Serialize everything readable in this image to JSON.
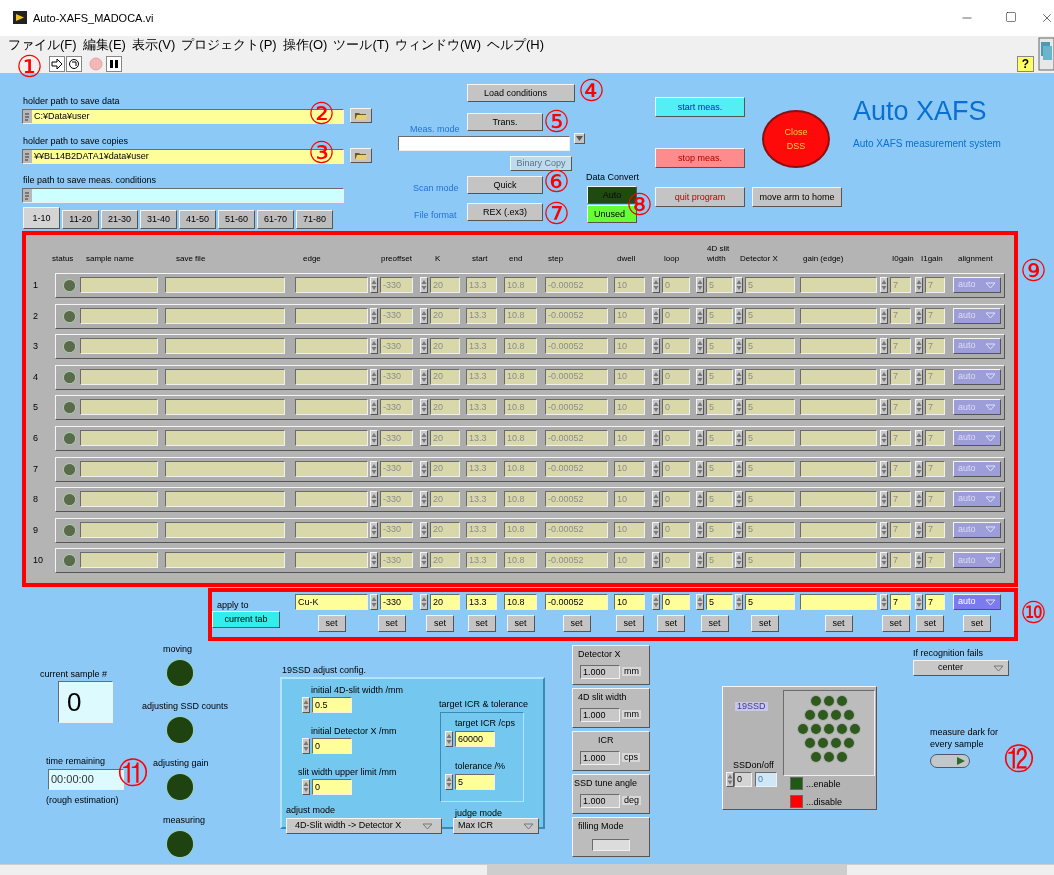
{
  "window": {
    "title": "Auto-XAFS_MADOCA.vi"
  },
  "menu": [
    "ファイル(F)",
    "編集(E)",
    "表示(V)",
    "プロジェクト(P)",
    "操作(O)",
    "ツール(T)",
    "ウィンドウ(W)",
    "ヘルプ(H)"
  ],
  "help_button": "?",
  "paths": [
    {
      "label": "holder path to save data",
      "value": "C:¥Data¥user",
      "browse": true
    },
    {
      "label": "holder path to save copies",
      "value": "¥¥BL14B2DATA1¥data¥user",
      "browse": true
    },
    {
      "label": "file path to save meas. conditions",
      "browse": false
    }
  ],
  "tabs": [
    {
      "label": "1-10",
      "selected": true
    },
    {
      "label": "11-20",
      "selected": false
    },
    {
      "label": "21-30",
      "selected": false
    },
    {
      "label": "31-40",
      "selected": false
    },
    {
      "label": "41-50",
      "selected": false
    },
    {
      "label": "51-60",
      "selected": false
    },
    {
      "label": "61-70",
      "selected": false
    },
    {
      "label": "71-80",
      "selected": false
    }
  ],
  "load_button": "Load conditions",
  "meas_mode": {
    "label": "Meas. mode",
    "value": "Trans."
  },
  "binary_copy": {
    "label": "Binary Copy",
    "disabled": true
  },
  "scan_mode": {
    "label": "Scan mode",
    "value": "Quick"
  },
  "file_format": {
    "label": "File format",
    "value": "REX (.ex3)"
  },
  "data_convert": {
    "label": "Data Convert",
    "options": [
      {
        "label": "Auto",
        "selected": false
      },
      {
        "label": "Unused",
        "selected": true
      }
    ]
  },
  "actions": [
    {
      "label": "start meas.",
      "kind": "start"
    },
    {
      "label": "stop meas.",
      "kind": "stop"
    },
    {
      "label": "quit program",
      "kind": "quit"
    },
    {
      "label": "move arm to home",
      "kind": "home"
    }
  ],
  "close_dss": "Close DSS",
  "brand": {
    "title": "Auto XAFS",
    "subtitle": "Auto XAFS measurement system"
  },
  "table": {
    "columns": [
      {
        "label": "status",
        "kind": "led"
      },
      {
        "label": "sample name",
        "kind": "field"
      },
      {
        "label": "save file",
        "kind": "field"
      },
      {
        "label": "edge",
        "kind": "field"
      },
      {
        "label": "preoffset",
        "kind": "spin"
      },
      {
        "label": "K",
        "kind": "spin"
      },
      {
        "label": "start",
        "kind": "field"
      },
      {
        "label": "end",
        "kind": "field"
      },
      {
        "label": "step",
        "kind": "field"
      },
      {
        "label": "dwell",
        "kind": "field"
      },
      {
        "label": "loop",
        "kind": "spin"
      },
      {
        "label": "4D slit width",
        "kind": "spin"
      },
      {
        "label": "Detector X",
        "kind": "spin"
      },
      {
        "label": "gain (edge)",
        "kind": "field"
      },
      {
        "label": "I0gain",
        "kind": "spin"
      },
      {
        "label": "I1gain",
        "kind": "spin"
      },
      {
        "label": "alignment",
        "kind": "menu"
      }
    ],
    "rows": [
      {
        "number": "1",
        "on": false,
        "cells": [
          "",
          "",
          "",
          "",
          "-330",
          "20",
          "13.3",
          "10.8",
          "-0.00052",
          "10",
          "0",
          "5",
          "5",
          "",
          "7",
          "7",
          "auto"
        ]
      },
      {
        "number": "2",
        "on": false,
        "cells": [
          "",
          "",
          "",
          "",
          "-330",
          "20",
          "13.3",
          "10.8",
          "-0.00052",
          "10",
          "0",
          "5",
          "5",
          "",
          "7",
          "7",
          "auto"
        ]
      },
      {
        "number": "3",
        "on": false,
        "cells": [
          "",
          "",
          "",
          "",
          "-330",
          "20",
          "13.3",
          "10.8",
          "-0.00052",
          "10",
          "0",
          "5",
          "5",
          "",
          "7",
          "7",
          "auto"
        ]
      },
      {
        "number": "4",
        "on": false,
        "cells": [
          "",
          "",
          "",
          "",
          "-330",
          "20",
          "13.3",
          "10.8",
          "-0.00052",
          "10",
          "0",
          "5",
          "5",
          "",
          "7",
          "7",
          "auto"
        ]
      },
      {
        "number": "5",
        "on": false,
        "cells": [
          "",
          "",
          "",
          "",
          "-330",
          "20",
          "13.3",
          "10.8",
          "-0.00052",
          "10",
          "0",
          "5",
          "5",
          "",
          "7",
          "7",
          "auto"
        ]
      },
      {
        "number": "6",
        "on": false,
        "cells": [
          "",
          "",
          "",
          "",
          "-330",
          "20",
          "13.3",
          "10.8",
          "-0.00052",
          "10",
          "0",
          "5",
          "5",
          "",
          "7",
          "7",
          "auto"
        ]
      },
      {
        "number": "7",
        "on": false,
        "cells": [
          "",
          "",
          "",
          "",
          "-330",
          "20",
          "13.3",
          "10.8",
          "-0.00052",
          "10",
          "0",
          "5",
          "5",
          "",
          "7",
          "7",
          "auto"
        ]
      },
      {
        "number": "8",
        "on": false,
        "cells": [
          "",
          "",
          "",
          "",
          "-330",
          "20",
          "13.3",
          "10.8",
          "-0.00052",
          "10",
          "0",
          "5",
          "5",
          "",
          "7",
          "7",
          "auto"
        ]
      },
      {
        "number": "9",
        "on": false,
        "cells": [
          "",
          "",
          "",
          "",
          "-330",
          "20",
          "13.3",
          "10.8",
          "-0.00052",
          "10",
          "0",
          "5",
          "5",
          "",
          "7",
          "7",
          "auto"
        ]
      },
      {
        "number": "10",
        "on": false,
        "cells": [
          "",
          "",
          "",
          "",
          "-330",
          "20",
          "13.3",
          "10.8",
          "-0.00052",
          "10",
          "0",
          "5",
          "5",
          "",
          "7",
          "7",
          "auto"
        ]
      }
    ]
  },
  "apply": {
    "label": "apply to",
    "target_button": "current tab",
    "cells": [
      {
        "value": "Cu-K",
        "button": "set"
      },
      {
        "value": "-330",
        "button": "set"
      },
      {
        "value": "20",
        "button": "set"
      },
      {
        "value": "13.3",
        "button": "set"
      },
      {
        "value": "10.8",
        "button": "set"
      },
      {
        "value": "-0.00052",
        "button": "set"
      },
      {
        "value": "10",
        "button": "set"
      },
      {
        "value": "0",
        "button": "set"
      },
      {
        "value": "5",
        "button": "set"
      },
      {
        "value": "5",
        "button": "set"
      },
      {
        "button": "set"
      },
      {
        "value": "7",
        "button": "set"
      },
      {
        "value": "7",
        "button": "set"
      },
      {
        "value": "auto",
        "button": "set"
      }
    ]
  },
  "current_sample": {
    "label": "current sample #",
    "value": "0"
  },
  "time_remaining": {
    "label": "time remaining",
    "value": "00:00:00",
    "note": "(rough estimation)"
  },
  "indicators": [
    {
      "label": "moving",
      "on": false
    },
    {
      "label": "adjusting SSD counts",
      "on": false
    },
    {
      "label": "adjusting gain",
      "on": false
    },
    {
      "label": "measuring",
      "on": false
    }
  ],
  "ssd_adjust": {
    "title": "19SSD adjust config.",
    "fields": [
      {
        "label": "initial 4D-slit width /mm",
        "value": "0.5"
      },
      {
        "label": "initial Detector X /mm",
        "value": "0"
      },
      {
        "label": "slit width upper limit /mm",
        "value": "0"
      }
    ],
    "target_group": {
      "title": "target ICR & tolerance",
      "fields": [
        {
          "label": "target ICR /cps",
          "value": "60000"
        },
        {
          "label": "tolerance /%",
          "value": "5"
        }
      ]
    },
    "adjust_mode": {
      "label": "adjust mode",
      "value": "4D-Slit width -> Detector X"
    },
    "judge_mode": {
      "label": "judge mode",
      "value": "Max ICR"
    }
  },
  "readouts": [
    {
      "label": "Detector X",
      "value": "1.000",
      "unit": "mm"
    },
    {
      "label": "4D slit width",
      "value": "1.000",
      "unit": "mm"
    },
    {
      "label": "ICR",
      "value": "1.000",
      "unit": "cps"
    },
    {
      "label": "SSD tune angle",
      "value": "1.000",
      "unit": "deg"
    },
    {
      "label": "filling Mode"
    }
  ],
  "ssd": {
    "title": "19SSD",
    "onoff_label": "SSDon/off",
    "onoff_value": "0",
    "index_display": "0",
    "channels": [
      {
        "enabled": true
      },
      {
        "enabled": true
      },
      {
        "enabled": true
      },
      {
        "enabled": true
      },
      {
        "enabled": true
      },
      {
        "enabled": true
      },
      {
        "enabled": true
      },
      {
        "enabled": true
      },
      {
        "enabled": true
      },
      {
        "enabled": true
      },
      {
        "enabled": true
      },
      {
        "enabled": true
      },
      {
        "enabled": true
      },
      {
        "enabled": true
      },
      {
        "enabled": true
      },
      {
        "enabled": true
      },
      {
        "enabled": true
      },
      {
        "enabled": true
      },
      {
        "enabled": true
      }
    ],
    "legend": [
      {
        "label": "...enable",
        "color": "#1e5a14"
      },
      {
        "label": "...disable",
        "color": "#ff0000"
      }
    ]
  },
  "recognition": {
    "label": "If recognition fails",
    "value": "center"
  },
  "dark": {
    "label": "measure dark for every sample",
    "on": false
  },
  "annotations": [
    "①",
    "②",
    "③",
    "④",
    "⑤",
    "⑥",
    "⑦",
    "⑧",
    "⑨",
    "⑩",
    "⑪",
    "⑫"
  ]
}
